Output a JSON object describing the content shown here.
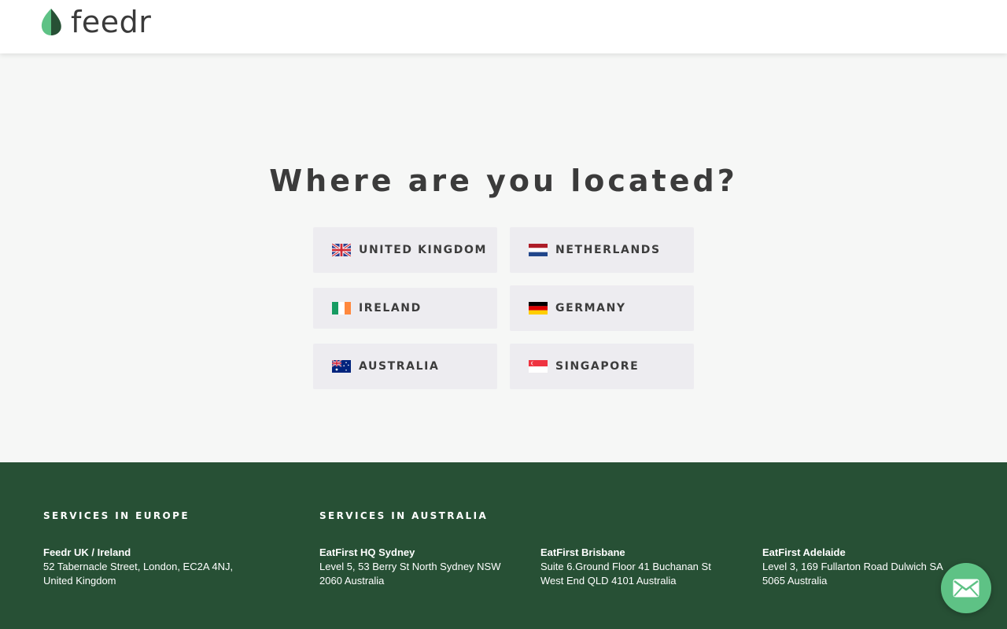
{
  "brand": {
    "name": "feedr",
    "colors": {
      "leaf_light": "#5ec285",
      "leaf_dark": "#275035",
      "text": "#3a3a3a"
    }
  },
  "main": {
    "heading": "Where are you located?",
    "countries": [
      {
        "label": "United Kingdom",
        "flag": "uk-flag-icon"
      },
      {
        "label": "Netherlands",
        "flag": "netherlands-flag-icon"
      },
      {
        "label": "Ireland",
        "flag": "ireland-flag-icon"
      },
      {
        "label": "Germany",
        "flag": "germany-flag-icon"
      },
      {
        "label": "Australia",
        "flag": "australia-flag-icon"
      },
      {
        "label": "Singapore",
        "flag": "singapore-flag-icon"
      }
    ],
    "button_bg": "#edecf0"
  },
  "footer": {
    "background": "#275035",
    "europe_heading": "Services in Europe",
    "australia_heading": "Services in Australia",
    "offices": [
      {
        "name": "Feedr UK / Ireland",
        "address": "52 Tabernacle Street, London, EC2A 4NJ,\nUnited Kingdom"
      },
      {
        "name": "EatFirst HQ Sydney",
        "address": "Level 5, 53 Berry St North Sydney NSW\n2060 Australia"
      },
      {
        "name": "EatFirst Brisbane",
        "address": "Suite 6.Ground Floor 41 Buchanan St\nWest End QLD 4101 Australia"
      },
      {
        "name": "EatFirst Adelaide",
        "address": "Level 3, 169 Fullarton Road Dulwich SA\n5065 Australia"
      }
    ]
  },
  "chat": {
    "icon": "mail-icon",
    "color": "#5ec285"
  }
}
